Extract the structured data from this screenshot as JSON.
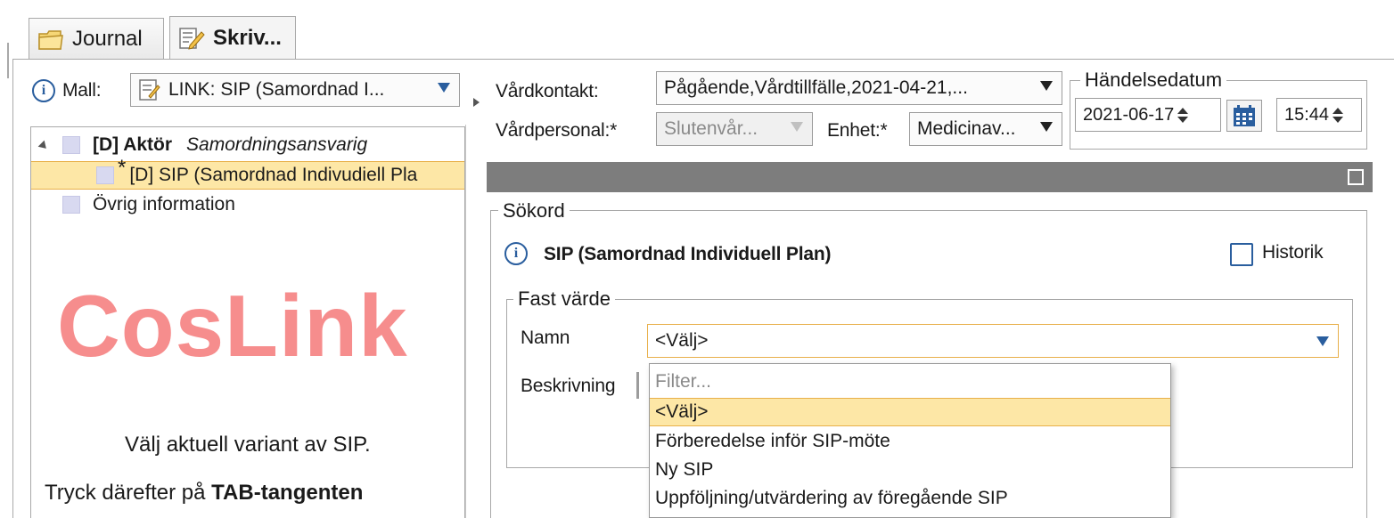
{
  "tabs": [
    {
      "label": "Journal",
      "icon": "journal-folder-icon",
      "active": false
    },
    {
      "label": "Skriv...",
      "icon": "write-note-icon",
      "active": true
    }
  ],
  "mall": {
    "label": "Mall:",
    "value": "LINK: SIP (Samordnad I..."
  },
  "tree": {
    "items": [
      {
        "bold": "[D] Aktör",
        "italic": "Samordningsansvarig"
      },
      {
        "prefix": "*",
        "label": "[D] SIP (Samordnad Indivudiell Pla"
      },
      {
        "label": "Övrig information"
      }
    ]
  },
  "watermark": "CosLink",
  "instructions": {
    "line1": "Välj aktuell variant av SIP.",
    "line2_normal": "Tryck därefter på ",
    "line2_bold": "TAB-tangenten"
  },
  "header": {
    "vardkontakt_label": "Vårdkontakt:",
    "vardkontakt_value": "Pågående,Vårdtillfälle,2021-04-21,...",
    "vardpersonal_label": "Vårdpersonal:*",
    "vardpersonal_value": "Slutenvår...",
    "enhet_label": "Enhet:*",
    "enhet_value": "Medicinav...",
    "handelsedatum_legend": "Händelsedatum",
    "date_value": "2021-06-17",
    "time_value": "15:44"
  },
  "sokord": {
    "legend": "Sökord",
    "title": "SIP (Samordnad Individuell Plan)",
    "historik_label": "Historik",
    "historik_checked": false
  },
  "fast_varde": {
    "legend": "Fast värde",
    "namn_label": "Namn",
    "namn_value": "<Välj>",
    "beskrivning_label": "Beskrivning"
  },
  "dropdown": {
    "filter_placeholder": "Filter...",
    "options": [
      {
        "label": "<Välj>",
        "selected": true
      },
      {
        "label": "Förberedelse inför SIP-möte",
        "selected": false
      },
      {
        "label": "Ny SIP",
        "selected": false
      },
      {
        "label": "Uppföljning/utvärdering av föregående SIP",
        "selected": false
      }
    ]
  },
  "colors": {
    "accent_blue": "#2a5e9e",
    "selection_yellow": "#fde7a6",
    "selection_border": "#e8b04a",
    "watermark_red": "#f46e6e",
    "grey_bar": "#7d7d7d"
  }
}
